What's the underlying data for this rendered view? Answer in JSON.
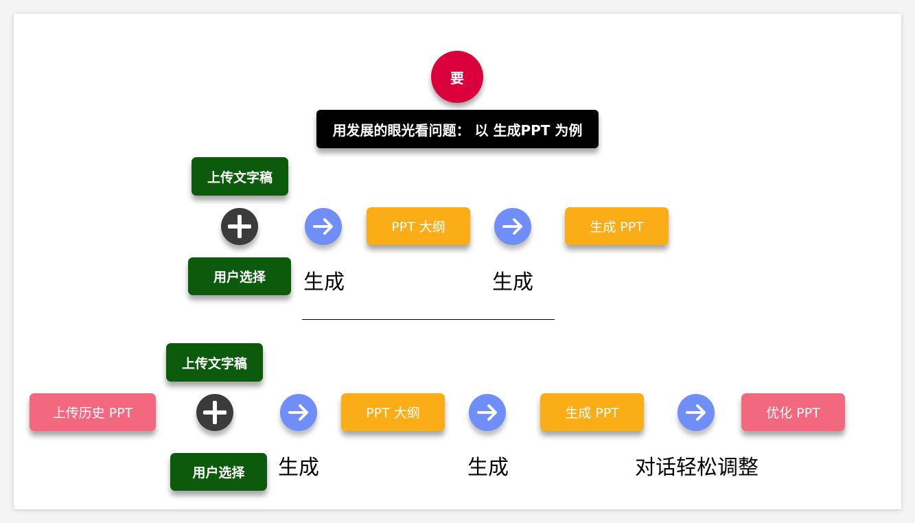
{
  "top_marker": "要",
  "title": "用发展的眼光看问题： 以 生成PPT 为例",
  "row1": {
    "upload_draft": "上传文字稿",
    "user_choice": "用户选择",
    "outline": "PPT  大纲",
    "generate_ppt": "生成 PPT",
    "gen_label_1": "生成",
    "gen_label_2": "生成"
  },
  "row2": {
    "upload_history": "上传历史 PPT",
    "upload_draft": "上传文字稿",
    "user_choice": "用户选择",
    "outline": "PPT  大纲",
    "generate_ppt": "生成 PPT",
    "optimize_ppt": "优化 PPT",
    "gen_label_1": "生成",
    "gen_label_2": "生成",
    "adjust_label": "对话轻松调整"
  },
  "colors": {
    "red": "#d9003c",
    "green": "#0c5a0c",
    "orange": "#fbad18",
    "pink": "#f2697f",
    "blue": "#6f8ef7",
    "dark": "#3b3b3b"
  },
  "icons": {
    "plus": "plus-circle-icon",
    "arrow": "arrow-right-circle-icon"
  }
}
